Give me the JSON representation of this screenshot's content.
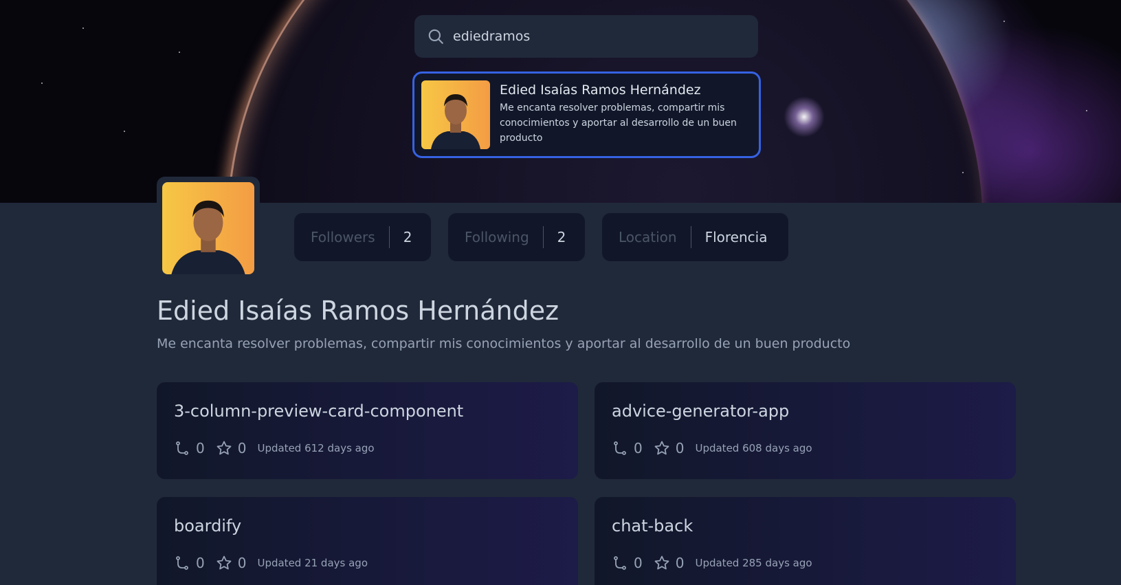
{
  "search": {
    "value": "ediedramos",
    "icon": "search-icon"
  },
  "result": {
    "name": "Edied Isaías Ramos Hernández",
    "bio": "Me encanta resolver problemas, compartir mis conocimientos y aportar al desarrollo de un buen producto"
  },
  "stats": [
    {
      "label": "Followers",
      "value": "2"
    },
    {
      "label": "Following",
      "value": "2"
    },
    {
      "label": "Location",
      "value": "Florencia"
    }
  ],
  "profile": {
    "name": "Edied Isaías Ramos Hernández",
    "bio": "Me encanta resolver problemas, compartir mis conocimientos y aportar al desarrollo de un buen producto"
  },
  "repos": [
    {
      "name": "3-column-preview-card-component",
      "forks": "0",
      "stars": "0",
      "updated": "Updated 612 days ago"
    },
    {
      "name": "advice-generator-app",
      "forks": "0",
      "stars": "0",
      "updated": "Updated 608 days ago"
    },
    {
      "name": "boardify",
      "forks": "0",
      "stars": "0",
      "updated": "Updated 21 days ago"
    },
    {
      "name": "chat-back",
      "forks": "0",
      "stars": "0",
      "updated": "Updated 285 days ago"
    }
  ],
  "colors": {
    "background": "#20293a",
    "card": "#111729",
    "accent": "#3662e3",
    "muted": "#4a5567"
  }
}
